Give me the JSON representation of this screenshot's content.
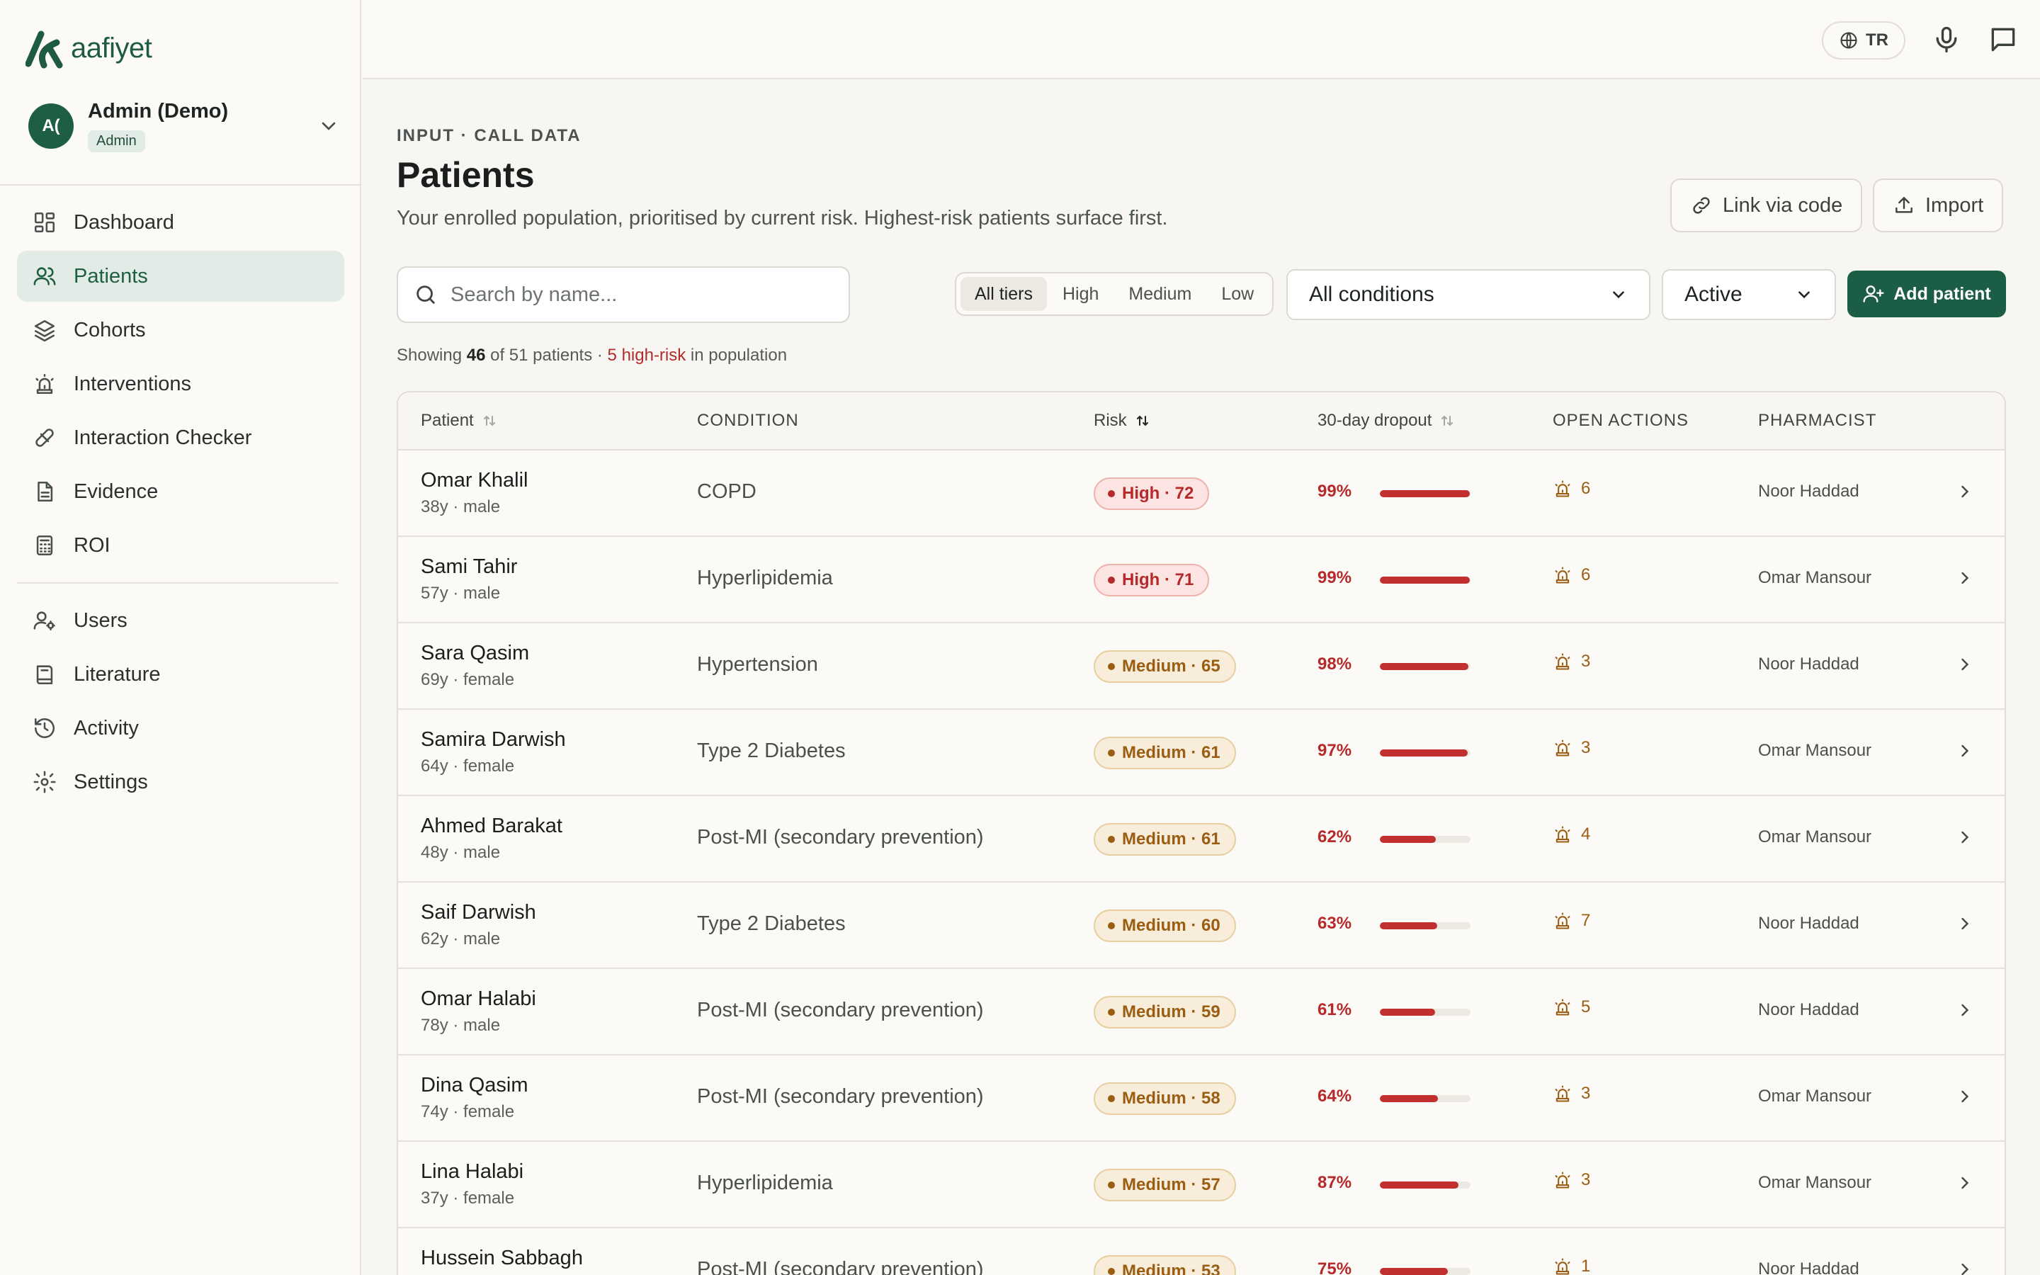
{
  "brand": {
    "name": "aafiyet"
  },
  "account": {
    "initials": "A(",
    "name": "Admin (Demo)",
    "role": "Admin"
  },
  "nav_main": [
    {
      "label": "Dashboard",
      "icon": "dashboard-icon"
    },
    {
      "label": "Patients",
      "icon": "users-icon",
      "active": true
    },
    {
      "label": "Cohorts",
      "icon": "layers-icon"
    },
    {
      "label": "Interventions",
      "icon": "siren-icon"
    },
    {
      "label": "Interaction Checker",
      "icon": "pill-icon"
    },
    {
      "label": "Evidence",
      "icon": "document-icon"
    },
    {
      "label": "ROI",
      "icon": "calculator-icon"
    }
  ],
  "nav_secondary": [
    {
      "label": "Users",
      "icon": "user-cog-icon"
    },
    {
      "label": "Literature",
      "icon": "book-icon"
    },
    {
      "label": "Activity",
      "icon": "history-icon"
    },
    {
      "label": "Settings",
      "icon": "gear-icon"
    }
  ],
  "topbar": {
    "language": "TR"
  },
  "page": {
    "eyebrow": "INPUT · CALL DATA",
    "title": "Patients",
    "subtitle": "Your enrolled population, prioritised by current risk. Highest-risk patients surface first.",
    "link_label": "Link via code",
    "import_label": "Import"
  },
  "filters": {
    "search_placeholder": "Search by name...",
    "tiers": [
      "All tiers",
      "High",
      "Medium",
      "Low"
    ],
    "condition": "All conditions",
    "status": "Active",
    "add_label": "Add patient"
  },
  "summary": {
    "prefix": "Showing ",
    "shown": "46",
    "middle": " of 51 patients · ",
    "highrisk": "5 high-risk",
    "suffix": " in population"
  },
  "table": {
    "headers": {
      "patient": "Patient",
      "condition": "CONDITION",
      "risk": "Risk",
      "dropout": "30-day dropout",
      "actions": "OPEN ACTIONS",
      "pharmacist": "PHARMACIST"
    },
    "rows": [
      {
        "name": "Omar Khalil",
        "meta": "38y · male",
        "condition": "COPD",
        "tier": "high",
        "risk": "High · 72",
        "dropout": "99%",
        "dropout_value": 0.99,
        "actions": "6",
        "pharmacist": "Noor Haddad"
      },
      {
        "name": "Sami Tahir",
        "meta": "57y · male",
        "condition": "Hyperlipidemia",
        "tier": "high",
        "risk": "High · 71",
        "dropout": "99%",
        "dropout_value": 0.99,
        "actions": "6",
        "pharmacist": "Omar Mansour"
      },
      {
        "name": "Sara Qasim",
        "meta": "69y · female",
        "condition": "Hypertension",
        "tier": "medium",
        "risk": "Medium · 65",
        "dropout": "98%",
        "dropout_value": 0.98,
        "actions": "3",
        "pharmacist": "Noor Haddad"
      },
      {
        "name": "Samira Darwish",
        "meta": "64y · female",
        "condition": "Type 2 Diabetes",
        "tier": "medium",
        "risk": "Medium · 61",
        "dropout": "97%",
        "dropout_value": 0.97,
        "actions": "3",
        "pharmacist": "Omar Mansour"
      },
      {
        "name": "Ahmed Barakat",
        "meta": "48y · male",
        "condition": "Post-MI (secondary prevention)",
        "tier": "medium",
        "risk": "Medium · 61",
        "dropout": "62%",
        "dropout_value": 0.62,
        "actions": "4",
        "pharmacist": "Omar Mansour"
      },
      {
        "name": "Saif Darwish",
        "meta": "62y · male",
        "condition": "Type 2 Diabetes",
        "tier": "medium",
        "risk": "Medium · 60",
        "dropout": "63%",
        "dropout_value": 0.63,
        "actions": "7",
        "pharmacist": "Noor Haddad"
      },
      {
        "name": "Omar Halabi",
        "meta": "78y · male",
        "condition": "Post-MI (secondary prevention)",
        "tier": "medium",
        "risk": "Medium · 59",
        "dropout": "61%",
        "dropout_value": 0.61,
        "actions": "5",
        "pharmacist": "Noor Haddad"
      },
      {
        "name": "Dina Qasim",
        "meta": "74y · female",
        "condition": "Post-MI (secondary prevention)",
        "tier": "medium",
        "risk": "Medium · 58",
        "dropout": "64%",
        "dropout_value": 0.64,
        "actions": "3",
        "pharmacist": "Omar Mansour"
      },
      {
        "name": "Lina Halabi",
        "meta": "37y · female",
        "condition": "Hyperlipidemia",
        "tier": "medium",
        "risk": "Medium · 57",
        "dropout": "87%",
        "dropout_value": 0.87,
        "actions": "3",
        "pharmacist": "Omar Mansour"
      },
      {
        "name": "Hussein Sabbagh",
        "meta": "",
        "condition": "Post-MI (secondary prevention)",
        "tier": "medium",
        "risk": "Medium · 53",
        "dropout": "75%",
        "dropout_value": 0.75,
        "actions": "1",
        "pharmacist": "Noor Haddad"
      }
    ]
  },
  "colors": {
    "accent": "#1b5e45",
    "high": "#b52a2a",
    "medium": "#9a5d12",
    "background": "#f7f6f2"
  }
}
